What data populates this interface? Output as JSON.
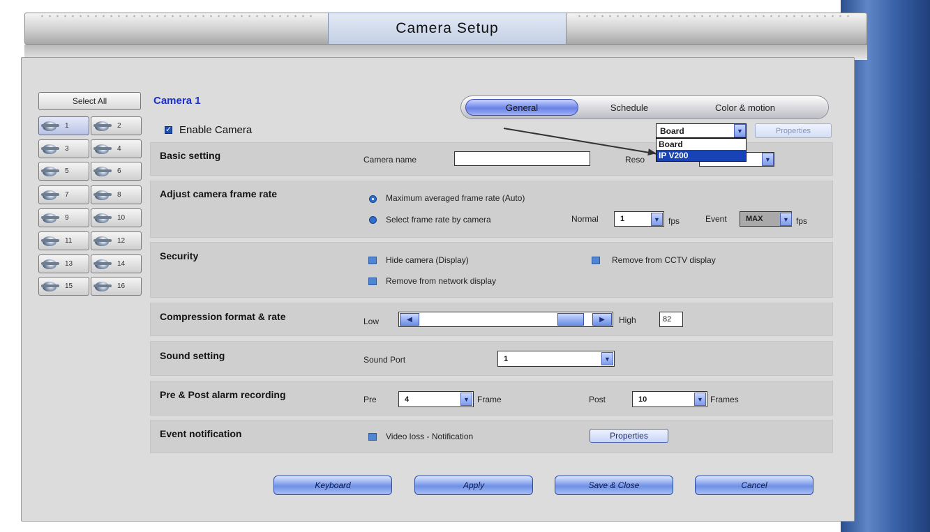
{
  "window": {
    "title": "Camera Setup"
  },
  "sidebar": {
    "select_all": "Select All",
    "cameras": [
      "1",
      "2",
      "3",
      "4",
      "5",
      "6",
      "7",
      "8",
      "9",
      "10",
      "11",
      "12",
      "13",
      "14",
      "15",
      "16"
    ],
    "selected": "1"
  },
  "header": {
    "camera_label": "Camera 1",
    "tabs": [
      "General",
      "Schedule",
      "Color & motion"
    ],
    "active_tab": "General",
    "enable_camera": "Enable Camera",
    "source_select": {
      "value": "Board",
      "options": [
        "Board",
        "IP V200"
      ],
      "highlighted": "IP V200"
    },
    "properties_top": "Properties"
  },
  "basic": {
    "title": "Basic setting",
    "camera_name_label": "Camera name",
    "camera_name_value": "",
    "resolution_label": "Reso"
  },
  "frame_rate": {
    "title": "Adjust camera frame rate",
    "option_auto": "Maximum averaged frame rate (Auto)",
    "option_manual": "Select frame rate by camera",
    "normal_label": "Normal",
    "normal_value": "1",
    "fps1": "fps",
    "event_label": "Event",
    "event_value": "MAX",
    "fps2": "fps"
  },
  "security": {
    "title": "Security",
    "hide_camera": "Hide camera (Display)",
    "remove_cctv": "Remove from CCTV display",
    "remove_network": "Remove from network display"
  },
  "compression": {
    "title": "Compression format & rate",
    "low": "Low",
    "high": "High",
    "value": "82"
  },
  "sound": {
    "title": "Sound setting",
    "port_label": "Sound Port",
    "port_value": "1"
  },
  "prepost": {
    "title": "Pre & Post alarm recording",
    "pre_label": "Pre",
    "pre_value": "4",
    "pre_unit": "Frame",
    "post_label": "Post",
    "post_value": "10",
    "post_unit": "Frames"
  },
  "event": {
    "title": "Event notification",
    "video_loss": "Video loss - Notification",
    "properties": "Properties"
  },
  "footer": {
    "keyboard": "Keyboard",
    "apply": "Apply",
    "save_close": "Save & Close",
    "cancel": "Cancel"
  },
  "colors": {
    "accent": "#1743b7",
    "panel": "#dcdcdc",
    "title_blue": "#1b2fc9"
  }
}
